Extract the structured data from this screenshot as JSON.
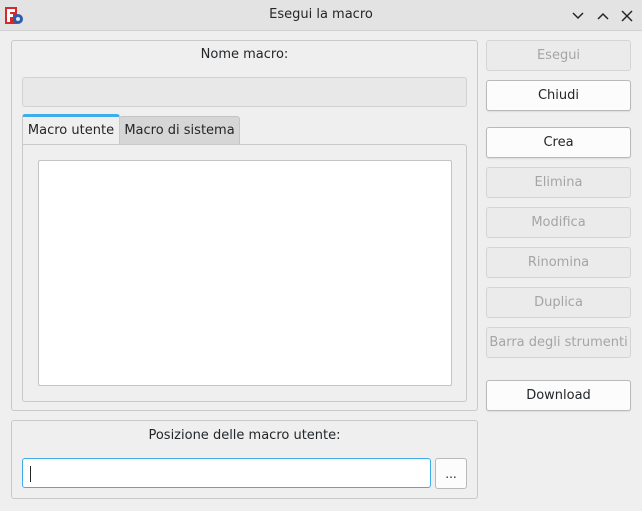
{
  "window": {
    "title": "Esegui la macro",
    "app_icon": "freecad-macro-icon",
    "controls": [
      "minimize-icon",
      "maximize-icon",
      "close-icon"
    ]
  },
  "macro_name": {
    "label": "Nome macro:",
    "value": ""
  },
  "tabs": [
    {
      "label": "Macro utente",
      "active": true
    },
    {
      "label": "Macro di sistema",
      "active": false
    }
  ],
  "macro_list": [],
  "buttons": {
    "execute": "Esegui",
    "close": "Chiudi",
    "create": "Crea",
    "delete": "Elimina",
    "edit": "Modifica",
    "rename": "Rinomina",
    "duplicate": "Duplica",
    "toolbar": "Barra degli strumenti",
    "download": "Download"
  },
  "user_macro_location": {
    "label": "Posizione delle macro utente:",
    "value": "",
    "browse_label": "..."
  },
  "colors": {
    "accent": "#3daee9",
    "window_bg": "#efefef",
    "disabled_text": "#a5a5a5"
  }
}
